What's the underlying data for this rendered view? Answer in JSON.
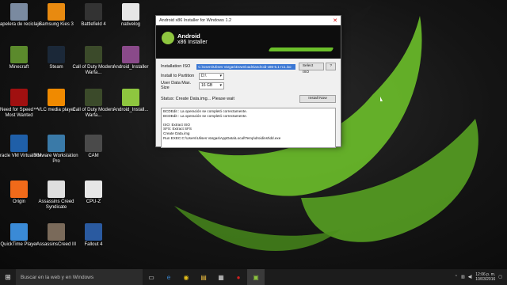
{
  "desktop_icons": [
    {
      "label": "Papelera de reciclaje",
      "icon": "recycle-bin-icon",
      "color": "#7a8aa0"
    },
    {
      "label": "Samsung Kies 3",
      "icon": "kies-icon",
      "color": "#e88a10"
    },
    {
      "label": "Battlefield 4",
      "icon": "battlefield-icon",
      "color": "#333"
    },
    {
      "label": "nativelog",
      "icon": "document-icon",
      "color": "#e6e6e6"
    },
    {
      "label": "Minecraft",
      "icon": "minecraft-icon",
      "color": "#5b8a2c"
    },
    {
      "label": "Steam",
      "icon": "steam-icon",
      "color": "#1b2838"
    },
    {
      "label": "Call of Duty Modern Warfa...",
      "icon": "cod-icon",
      "color": "#3b4a2a"
    },
    {
      "label": "Android_Installer",
      "icon": "installer-icon",
      "color": "#8a4a8a"
    },
    {
      "label": "Need for Speed™ Most Wanted",
      "icon": "nfs-icon",
      "color": "#a01010"
    },
    {
      "label": "VLC media player",
      "icon": "vlc-icon",
      "color": "#f08a00"
    },
    {
      "label": "Call of Duty Modern Warfa...",
      "icon": "cod-icon",
      "color": "#3b4a2a"
    },
    {
      "label": "Android_Install...",
      "icon": "android-icon",
      "color": "#8ec63f"
    },
    {
      "label": "Oracle VM VirtualBox",
      "icon": "virtualbox-icon",
      "color": "#1f5fa8"
    },
    {
      "label": "VMware Workstation Pro",
      "icon": "vmware-icon",
      "color": "#3a7aa8"
    },
    {
      "label": "CAM",
      "icon": "cam-icon",
      "color": "#4a4a4a"
    },
    {
      "label": "Origin",
      "icon": "origin-icon",
      "color": "#f06a1a"
    },
    {
      "label": "Assassins Creed Syndicate",
      "icon": "ac-icon",
      "color": "#dedede"
    },
    {
      "label": "CPU-Z",
      "icon": "document-icon",
      "color": "#e6e6e6"
    },
    {
      "label": "QuickTime Player",
      "icon": "quicktime-icon",
      "color": "#3a8ad6"
    },
    {
      "label": "AssassinsCreed III",
      "icon": "ac3-icon",
      "color": "#7a6a5a"
    },
    {
      "label": "Fallout 4",
      "icon": "fallout-icon",
      "color": "#2a5aa0"
    }
  ],
  "window": {
    "title": "Android x86 Installer for Windows 1.2",
    "close": "✕",
    "banner_line1": "Android",
    "banner_line2": "x86 Installer",
    "installation_iso_label": "Installation ISO",
    "iso_path": "C:\\Users\\Ulises Vargas\\Downloads\\android-x86-5.1-rc1.iso",
    "select_iso": "Select ISO",
    "help": "?",
    "install_to_partition_label": "Install to Partition",
    "partition_value": "D:\\",
    "user_data_label": "User Data Max. Size",
    "user_data_value": "16 GB",
    "status": "Status: Create Data.img... Please wait",
    "install_now": "Install Now",
    "log_lines": [
      "BCDEdit : La operación se completó correctamente.",
      "BCDEdit : La operación se completó correctamente.",
      "",
      "ISO: Extract ISO",
      "SFS: Extract SFS",
      "Create Data.img",
      "Run EXEC:C:\\Users\\Ulises Vargas\\AppData\\Local\\Temp\\droidinst\\dd.exe"
    ]
  },
  "taskbar": {
    "start": "⊞",
    "search_placeholder": "Buscar en la web y en Windows",
    "time": "12:06 p. m.",
    "date": "10/03/2016"
  },
  "colors": {
    "accent": "#8ec63f",
    "selection": "#3a77d4"
  }
}
